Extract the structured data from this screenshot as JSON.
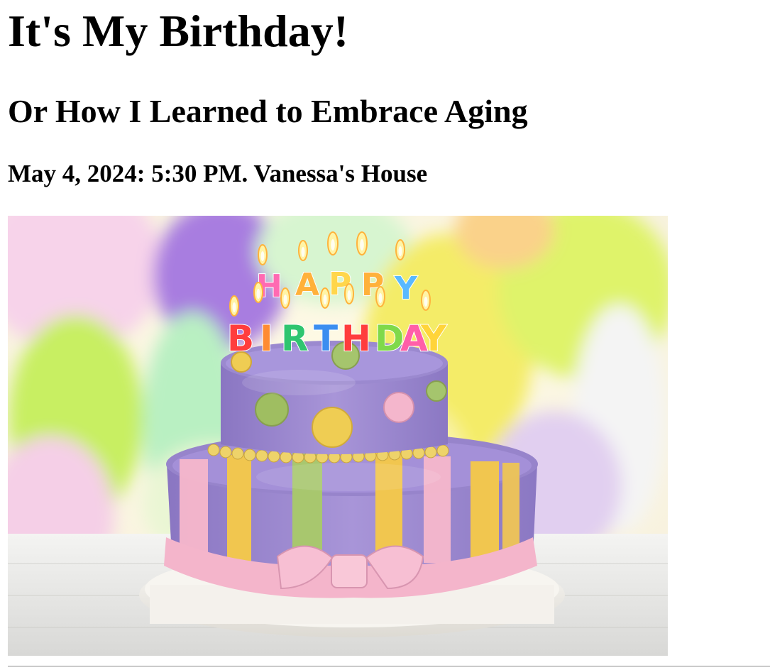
{
  "header": {
    "title": "It's My Birthday!",
    "subtitle": "Or How I Learned to Embrace Aging",
    "details": "May 4, 2024: 5:30 PM. Vanessa's House"
  },
  "image": {
    "icon": "birthday-cake-photo",
    "candles_top": [
      "H",
      "A",
      "P",
      "P",
      "Y"
    ],
    "candles_bottom": [
      "B",
      "I",
      "R",
      "T",
      "H",
      "D",
      "A",
      "Y"
    ],
    "candle_colors": [
      "#ff5fa8",
      "#ffb020",
      "#ffd83d",
      "#ff8a3d",
      "#4fb3ff",
      "#ff3b3b",
      "#2cc46d",
      "#7bd94a"
    ],
    "cake_colors": {
      "tier": "#9b86cf",
      "yellow": "#f4c84a",
      "green": "#a9c76a",
      "pink": "#f4b6cc",
      "board": "#f3f1ec"
    },
    "balloon_colors": [
      "#b78be8",
      "#dff06a",
      "#f7f46a",
      "#bff2a4",
      "#f3c2e6",
      "#ffffff"
    ]
  }
}
